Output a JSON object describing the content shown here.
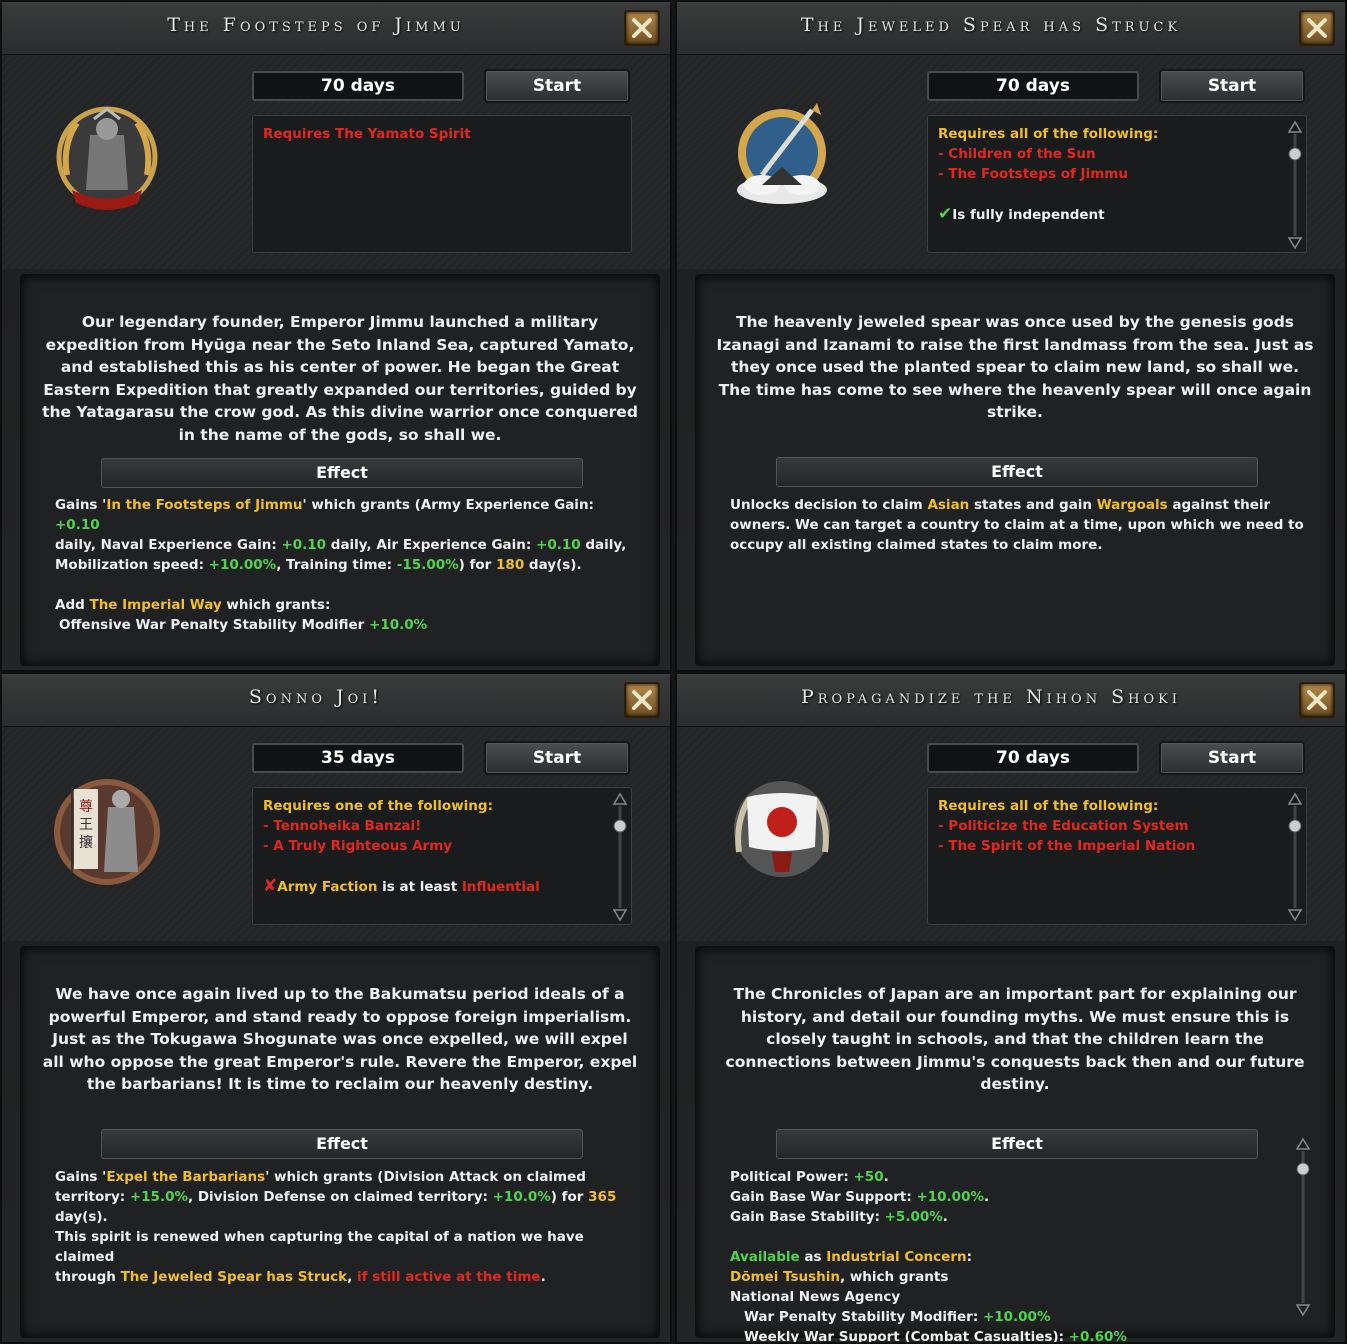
{
  "panels": [
    {
      "title": "The Footsteps of Jimmu",
      "duration": "70 days",
      "start_label": "Start",
      "icon": "samurai-warrior-icon",
      "requirements": {
        "single": "Requires The Yamato Spirit"
      },
      "description": "Our legendary founder, Emperor Jimmu launched a military expedition from Hyūga near the Seto Inland Sea, captured Yamato, and established this as his center of power. He began the Great Eastern Expedition that greatly expanded our territories, guided by the Yatagarasu the crow god. As this divine warrior once conquered in the name of the gods, so shall we.",
      "effect_label": "Effect",
      "effect": {
        "l1a": "Gains '",
        "l1b": "In the Footsteps of Jimmu",
        "l1c": "' which grants (Army Experience Gain: ",
        "l1d": "+0.10",
        "l2a": "daily, Naval Experience Gain: ",
        "l2b": "+0.10",
        "l2c": " daily, Air Experience Gain: ",
        "l2d": "+0.10",
        "l2e": " daily,",
        "l3a": "Mobilization speed: ",
        "l3b": "+10.00%",
        "l3c": ", Training time: ",
        "l3d": "-15.00%",
        "l3e": ") for ",
        "l3f": "180",
        "l3g": " day(s).",
        "l4a": "Add ",
        "l4b": "The Imperial Way",
        "l4c": " which grants:",
        "l5a": "Offensive War Penalty Stability Modifier ",
        "l5b": "+10.0%"
      }
    },
    {
      "title": "The Jeweled Spear has Struck",
      "duration": "70 days",
      "start_label": "Start",
      "icon": "jeweled-spear-icon",
      "requirements": {
        "header": "Requires all of the following:",
        "items": [
          "- Children of the Sun",
          "- The Footsteps of Jimmu"
        ],
        "check": "Is fully independent"
      },
      "description": "The heavenly jeweled spear was once used by the genesis gods Izanagi and Izanami to raise the first landmass from the sea. Just as they once used the planted spear to claim new land, so shall we. The time has come to see where the heavenly spear will once again strike.",
      "effect_label": "Effect",
      "effect": {
        "l1a": "Unlocks decision to claim ",
        "l1b": "Asian",
        "l1c": " states and gain ",
        "l1d": "Wargoals",
        "l1e": " against their",
        "l2": "owners. We can target a country to claim at a time, upon which we need to",
        "l3": "occupy all existing claimed states to claim more."
      }
    },
    {
      "title": "Sonno Joi!",
      "duration": "35 days",
      "start_label": "Start",
      "icon": "banner-soldier-icon",
      "requirements": {
        "header": "Requires one of the following:",
        "items": [
          "- Tennoheika Banzai!",
          "- A Truly Righteous Army"
        ],
        "fail_a": "Army Faction",
        "fail_b": " is at least ",
        "fail_c": "Influential"
      },
      "description": "We have once again lived up to the Bakumatsu period ideals of a powerful Emperor, and stand ready to oppose foreign imperialism. Just as the Tokugawa Shogunate was once expelled, we will expel all who oppose the great Emperor's rule. Revere the Emperor, expel the barbarians! It is time to reclaim our heavenly destiny.",
      "effect_label": "Effect",
      "effect": {
        "l1a": "Gains '",
        "l1b": "Expel the Barbarians",
        "l1c": "' which grants (Division Attack on claimed",
        "l2a": "territory: ",
        "l2b": "+15.0%",
        "l2c": ", Division Defense on claimed territory: ",
        "l2d": "+10.0%",
        "l2e": ") for ",
        "l2f": "365",
        "l3": "day(s).",
        "l4": "This spirit is renewed when capturing the capital of a nation we have claimed",
        "l5a": "through ",
        "l5b": "The Jeweled Spear has Struck",
        "l5c": ", ",
        "l5d": "if still active at the time",
        "l5e": "."
      }
    },
    {
      "title": "Propagandize the Nihon Shoki",
      "duration": "70 days",
      "start_label": "Start",
      "icon": "rising-sun-flag-icon",
      "requirements": {
        "header": "Requires all of the following:",
        "items": [
          "- Politicize the Education System",
          "- The Spirit of the Imperial Nation"
        ]
      },
      "description": "The Chronicles of Japan are an important part for explaining our history, and detail our founding myths. We must ensure this is closely taught in schools, and that the children learn the connections between Jimmu's conquests back then and our future destiny.",
      "effect_label": "Effect",
      "effect": {
        "l1a": "Political Power: ",
        "l1b": "+50",
        "l1c": ".",
        "l2a": "Gain Base War Support: ",
        "l2b": "+10.00%",
        "l2c": ".",
        "l3a": "Gain Base Stability: ",
        "l3b": "+5.00%",
        "l3c": ".",
        "l4a": "Available",
        "l4b": " as ",
        "l4c": "Industrial Concern",
        "l4d": ":",
        "l5a": "Dōmei Tsushin",
        "l5b": ", which grants",
        "l6": "National News Agency",
        "l7a": "War Penalty Stability Modifier: ",
        "l7b": "+10.00%",
        "l8a": "Weekly War Support (Combat Casualties): ",
        "l8b": "+0.60%"
      }
    }
  ]
}
